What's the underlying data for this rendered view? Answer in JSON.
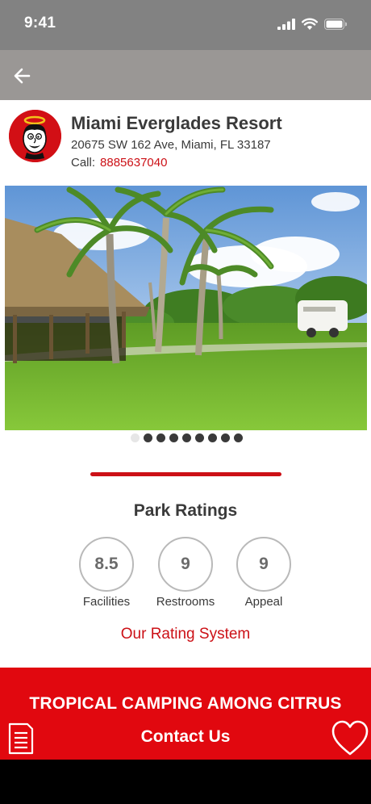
{
  "status_bar": {
    "time": "9:41",
    "icons": [
      "signal-icon",
      "wifi-icon",
      "battery-icon"
    ]
  },
  "nav": {
    "back_icon": "arrow-left-icon"
  },
  "park": {
    "name": "Miami Everglades Resort",
    "address": "20675 SW 162 Ave, Miami, FL 33187",
    "call_label": "Call:",
    "phone": "8885637040"
  },
  "gallery": {
    "photo_count": 9,
    "active_index": 0
  },
  "ratings": {
    "title": "Park Ratings",
    "items": [
      {
        "value": "8.5",
        "label": "Facilities"
      },
      {
        "value": "9",
        "label": "Restrooms"
      },
      {
        "value": "9",
        "label": "Appeal"
      }
    ],
    "system_link": "Our Rating System"
  },
  "promo": {
    "tagline": "TROPICAL CAMPING AMONG CITRUS",
    "contact_label": "Contact Us",
    "menu_icon": "menu-list-icon",
    "favorite_icon": "heart-icon"
  },
  "colors": {
    "accent_red": "#cc1016",
    "promo_red": "#e1080f",
    "status_bar": "#828282",
    "nav_bar": "#9a9795"
  }
}
